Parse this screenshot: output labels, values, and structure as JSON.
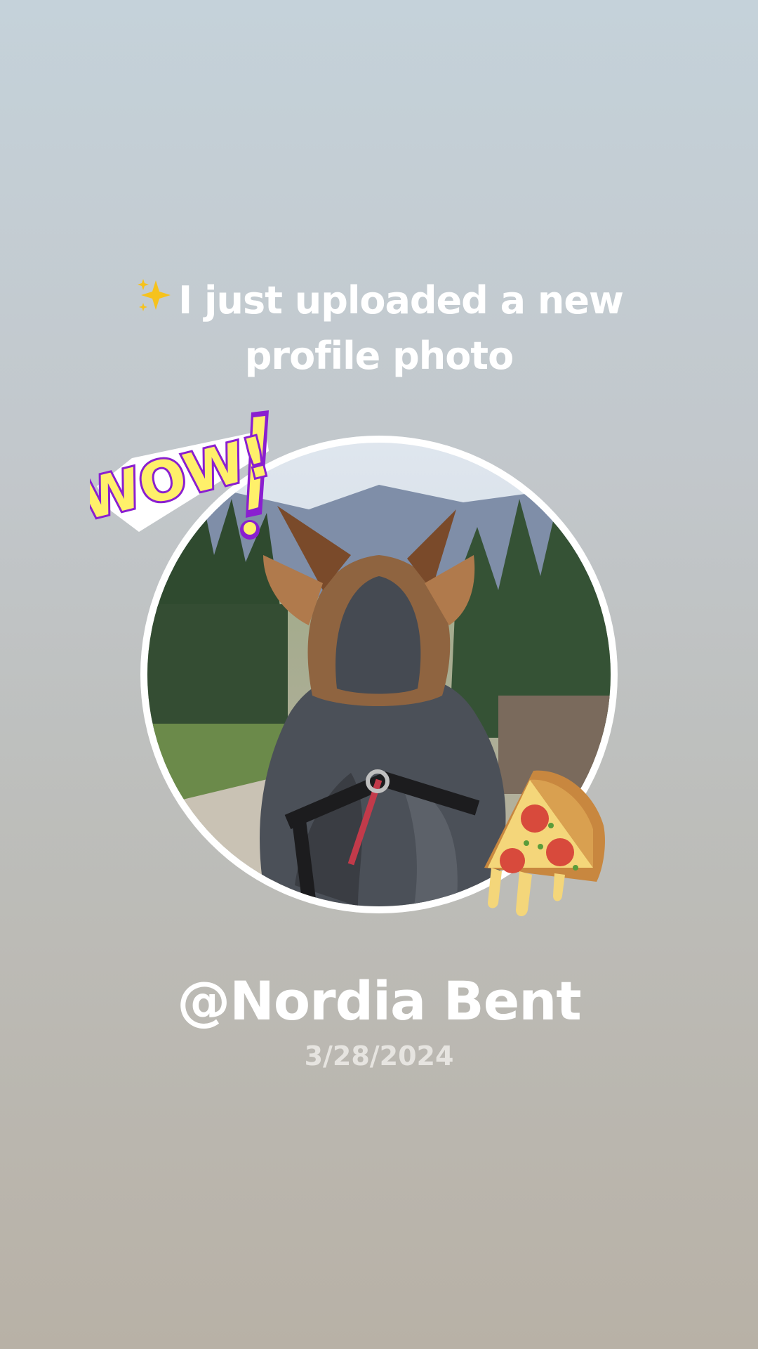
{
  "post": {
    "sparkle_icon": "sparkles-icon",
    "announcement": "I just uploaded a new profile photo",
    "profile_photo": "dog-back-view-photo",
    "stickers": [
      "wow-sticker",
      "pizza-slice-sticker"
    ],
    "wow_text": "WOW!",
    "username": "@Nordia Bent",
    "date": "3/28/2024"
  },
  "colors": {
    "background_top": "#c5d2da",
    "background_bottom": "#b8b1a6",
    "text": "#ffffff",
    "date_text": "#e6e4e0",
    "wow_yellow": "#fff06a",
    "wow_purple": "#8a1fd0"
  }
}
